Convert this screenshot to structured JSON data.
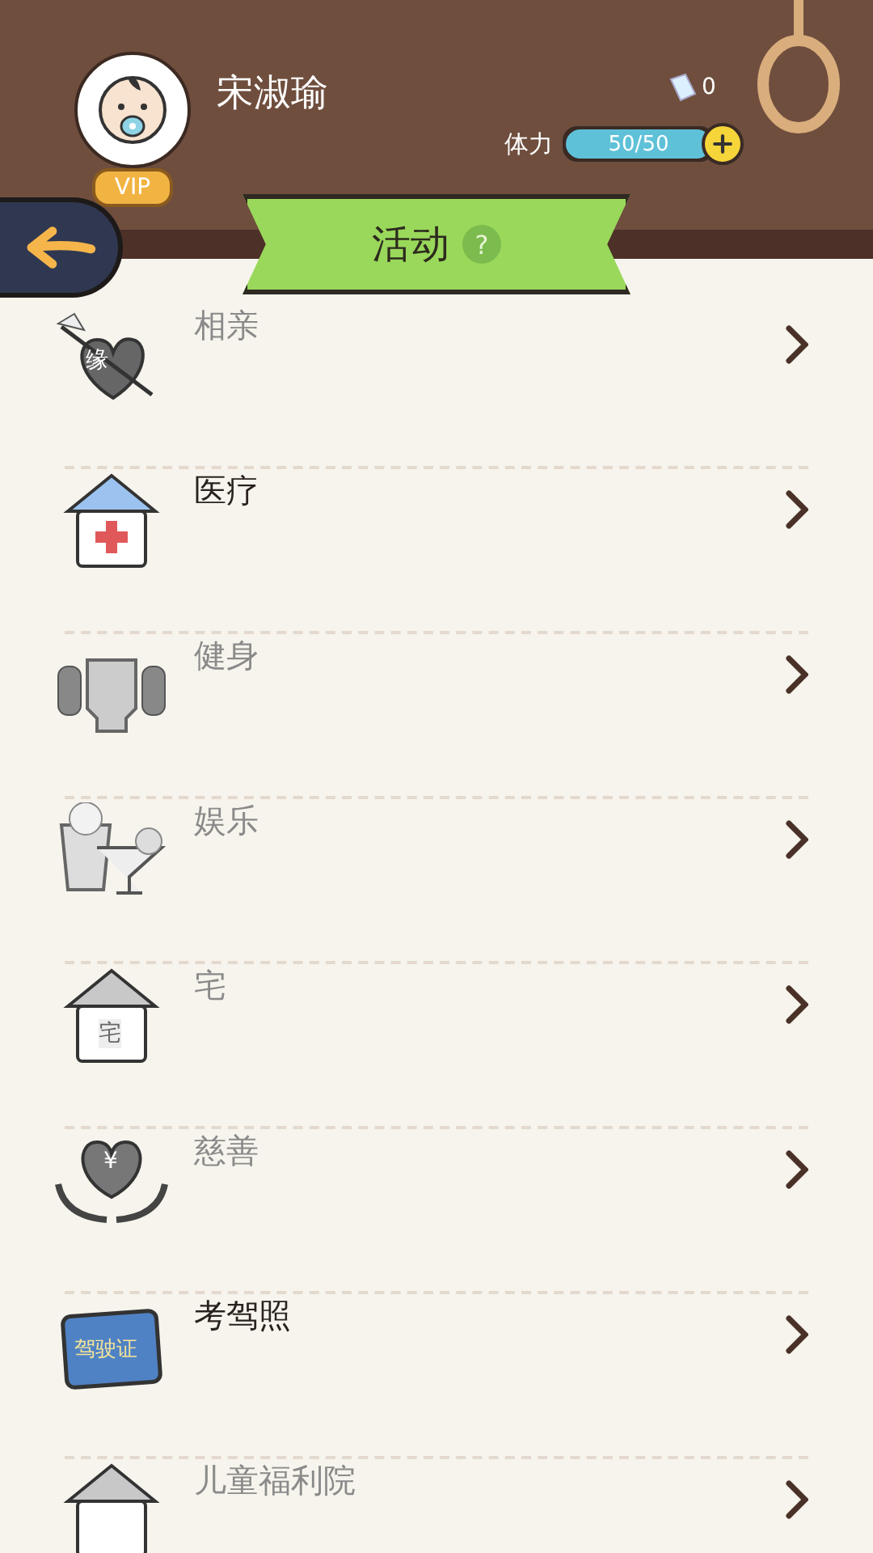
{
  "profile": {
    "name": "宋淑瑜",
    "vip_badge": "VIP",
    "tickets": "0",
    "stamina_label": "体力",
    "stamina_reading": "50/50",
    "stamina": {
      "level": 1
    }
  },
  "header": {
    "title": "活动",
    "help": "?"
  },
  "activities": [
    {
      "title": "相亲",
      "kind": "heart",
      "icon_text": "缘",
      "disabled": true
    },
    {
      "title": "医疗",
      "kind": "clinic",
      "disabled": false
    },
    {
      "title": "健身",
      "kind": "dumbbell",
      "disabled": true
    },
    {
      "title": "娱乐",
      "kind": "party",
      "disabled": true
    },
    {
      "title": "宅",
      "kind": "house",
      "icon_text": "宅",
      "disabled": true
    },
    {
      "title": "慈善",
      "kind": "charity",
      "icon_text": "¥",
      "disabled": true
    },
    {
      "title": "考驾照",
      "kind": "license",
      "icon_text": "驾驶证",
      "disabled": false
    },
    {
      "title": "儿童福利院",
      "kind": "house",
      "disabled": true
    }
  ]
}
